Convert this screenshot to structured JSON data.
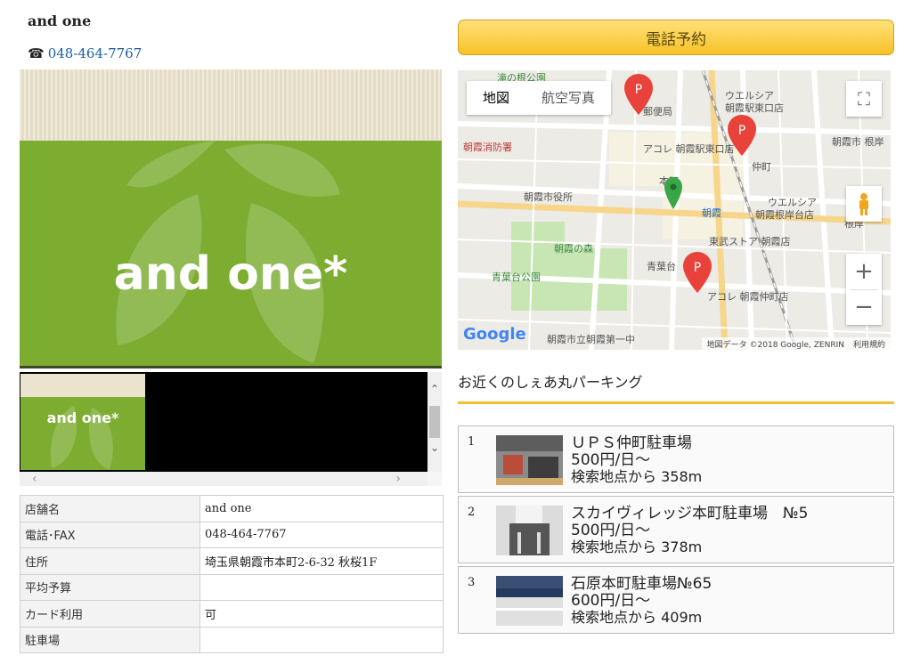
{
  "shop": {
    "name": "and one",
    "tel": "048-464-7767",
    "tel_icon": "☎",
    "brand_logo": "and one*"
  },
  "table": {
    "rows": [
      {
        "label": "店舗名",
        "value": "and one"
      },
      {
        "label": "電話･FAX",
        "value": "048-464-7767"
      },
      {
        "label": "住所",
        "value": "埼玉県朝霞市本町2-6-32 秋桜1F"
      },
      {
        "label": "平均予算",
        "value": ""
      },
      {
        "label": "カード利用",
        "value": "可"
      },
      {
        "label": "駐車場",
        "value": ""
      }
    ]
  },
  "reserve_button": "電話予約",
  "map": {
    "type_map": "地図",
    "type_satellite": "航空写真",
    "labels": {
      "top": "滝の根公園",
      "post": "郵便局",
      "fire": "朝霞消防署",
      "welcia1": "ウエルシア",
      "welcia1b": "朝霞駅東口店",
      "acore1": "アコレ 朝霞駅東口店",
      "nakacho": "仲町",
      "nejiku": "朝霞市 根岸",
      "cityhall": "朝霞市役所",
      "honcho": "本町",
      "station": "朝霞",
      "welcia2": "ウエルシア",
      "welcia2b": "朝霞根岸台店",
      "tobu": "東武ストア 朝霞店",
      "forest": "朝霞の森",
      "aobadai": "青葉台",
      "aobapark": "青葉台公園",
      "acore2": "アコレ 朝霞仲町店",
      "school": "朝霞市立朝霞第一中",
      "nejiku2": "根岸"
    },
    "attribution": "地図データ ©2018 Google, ZENRIN",
    "terms": "利用規約",
    "google": "Google"
  },
  "nearby": {
    "title": "お近くのしぇあ丸パーキング",
    "items": [
      {
        "num": "1",
        "name": "ＵＰＳ仲町駐車場",
        "price": "500円/日～",
        "dist": "検索地点から 358m"
      },
      {
        "num": "2",
        "name": "スカイヴィレッジ本町駐車場　№5",
        "price": "500円/日～",
        "dist": "検索地点から 378m"
      },
      {
        "num": "3",
        "name": "石原本町駐車場№65",
        "price": "600円/日～",
        "dist": "検索地点から 409m"
      }
    ]
  }
}
